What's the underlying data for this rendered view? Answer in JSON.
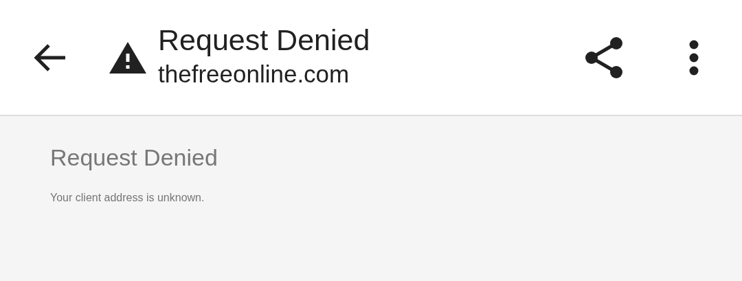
{
  "toolbar": {
    "title": "Request Denied",
    "subtitle": "thefreeonline.com"
  },
  "page": {
    "heading": "Request Denied",
    "message": "Your client address is unknown."
  }
}
